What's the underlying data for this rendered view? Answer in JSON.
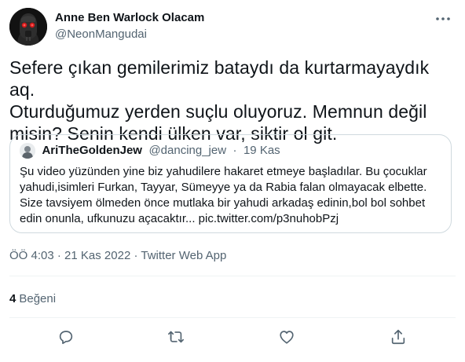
{
  "author": {
    "display_name": "Anne Ben Warlock Olacam",
    "handle": "@NeonMangudai",
    "avatar_icon": "masked-figure-avatar"
  },
  "tweet": {
    "text": "Sefere çıkan gemilerimiz bataydı da kurtarmayaydık aq.\nOturduğumuz yerden suçlu oluyoruz. Memnun değil\nmisin? Senin kendi ülken var, siktir ol git."
  },
  "quoted_tweet": {
    "display_name": "AriTheGoldenJew",
    "handle": "@dancing_jew",
    "separator": "·",
    "date": "19 Kas",
    "text": "Şu video yüzünden yine biz yahudilere hakaret etmeye başladılar. Bu çocuklar\nyahudi,isimleri Furkan, Tayyar, Sümeyye ya da Rabia falan olmayacak elbette.\nSize tavsiyem ölmeden önce mutlaka bir yahudi arkadaş edinin,bol bol sohbet\nedin onunla, ufkunuzu açacaktır... pic.twitter.com/p3nuhobPzj"
  },
  "meta": {
    "time": "ÖÖ 4:03",
    "date": "21 Kas 2022",
    "source": "Twitter Web App",
    "separator": "·"
  },
  "stats": {
    "likes_count": "4",
    "likes_label": "Beğeni"
  },
  "actions": {
    "icons": [
      "reply-icon",
      "retweet-icon",
      "like-icon",
      "share-icon"
    ]
  },
  "colors": {
    "text_primary": "#0f1419",
    "text_secondary": "#536471",
    "border": "#cfd9de",
    "divider": "#eff3f4",
    "accent_red": "#c81e1e"
  }
}
